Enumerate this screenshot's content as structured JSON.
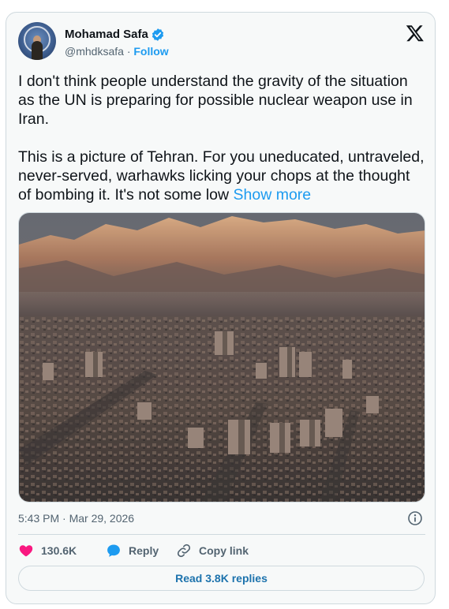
{
  "author": {
    "name": "Mohamad Safa",
    "handle": "@mhdksafa",
    "separator": "·",
    "follow_label": "Follow"
  },
  "tweet": {
    "text": "I don't think people understand the gravity of the situation as the UN is preparing for possible nuclear weapon use in Iran.\n\nThis is a picture of Tehran. For you uneducated, untraveled, never-served, warhawks licking your chops at the thought of bombing it. It's not some low ",
    "show_more_label": "Show more",
    "timestamp": "5:43 PM · Mar 29, 2026"
  },
  "actions": {
    "likes": "130.6K",
    "reply_label": "Reply",
    "copy_link_label": "Copy link"
  },
  "read_replies_label": "Read 3.8K replies",
  "colors": {
    "accent": "#1d9bf0",
    "like": "#f91880",
    "verified": "#1d9bf0"
  },
  "icons": [
    "x-logo-icon",
    "verified-badge-icon",
    "info-icon",
    "heart-icon",
    "reply-icon",
    "link-icon"
  ]
}
